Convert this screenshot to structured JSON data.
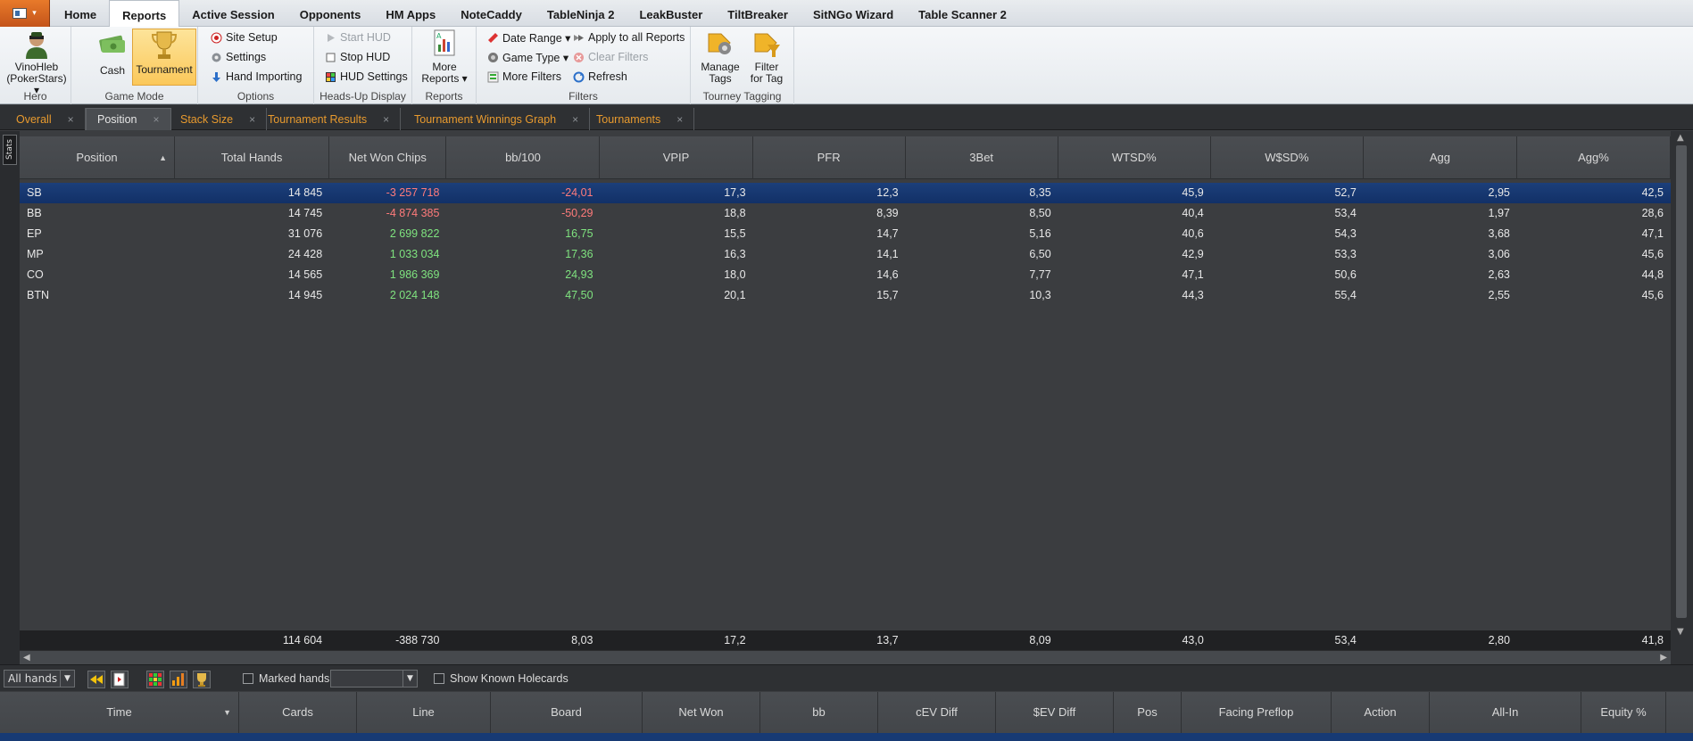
{
  "menu": {
    "items": [
      "Home",
      "Reports",
      "Active Session",
      "Opponents",
      "HM Apps",
      "NoteCaddy",
      "TableNinja 2",
      "LeakBuster",
      "TiltBreaker",
      "SitNGo Wizard",
      "Table Scanner 2"
    ],
    "active": "Reports"
  },
  "ribbon": {
    "hero": {
      "name": "VinoHleb",
      "site": "(PokerStars) ▾",
      "group_label": "Hero"
    },
    "game_mode": {
      "cash": "Cash",
      "tournament": "Tournament",
      "group_label": "Game Mode"
    },
    "options": {
      "site_setup": "Site Setup",
      "settings": "Settings",
      "hand_importing": "Hand Importing",
      "group_label": "Options"
    },
    "hud": {
      "start": "Start HUD",
      "stop": "Stop HUD",
      "settings": "HUD Settings",
      "group_label": "Heads-Up Display"
    },
    "reports": {
      "more_line1": "More",
      "more_line2": "Reports ▾",
      "group_label": "Reports"
    },
    "filters": {
      "date_range": "Date Range ▾",
      "game_type": "Game Type ▾",
      "more_filters": "More Filters",
      "apply_all": "Apply to all Reports",
      "clear": "Clear Filters",
      "refresh": "Refresh",
      "group_label": "Filters"
    },
    "tagging": {
      "manage_line1": "Manage",
      "manage_line2": "Tags",
      "filter_line1": "Filter",
      "filter_line2": "for Tag",
      "group_label": "Tourney Tagging"
    }
  },
  "tabs": [
    {
      "label": "Overall",
      "active": false
    },
    {
      "label": "Position",
      "active": true
    },
    {
      "label": "Stack Size",
      "active": false
    },
    {
      "label": "Tournament Results",
      "active": false
    },
    {
      "label": "Tournament Winnings Graph",
      "active": false
    },
    {
      "label": "Tournaments",
      "active": false
    }
  ],
  "sidebar": {
    "stats_label": "Stats"
  },
  "grid": {
    "columns": [
      "Position",
      "Total Hands",
      "Net Won Chips",
      "bb/100",
      "VPIP",
      "PFR",
      "3Bet",
      "WTSD%",
      "W$SD%",
      "Agg",
      "Agg%"
    ],
    "rows": [
      [
        "SB",
        "14 845",
        "-3 257 718",
        "-24,01",
        "17,3",
        "12,3",
        "8,35",
        "45,9",
        "52,7",
        "2,95",
        "42,5"
      ],
      [
        "BB",
        "14 745",
        "-4 874 385",
        "-50,29",
        "18,8",
        "8,39",
        "8,50",
        "40,4",
        "53,4",
        "1,97",
        "28,6"
      ],
      [
        "EP",
        "31 076",
        "2 699 822",
        "16,75",
        "15,5",
        "14,7",
        "5,16",
        "40,6",
        "54,3",
        "3,68",
        "47,1"
      ],
      [
        "MP",
        "24 428",
        "1 033 034",
        "17,36",
        "16,3",
        "14,1",
        "6,50",
        "42,9",
        "53,3",
        "3,06",
        "45,6"
      ],
      [
        "CO",
        "14 565",
        "1 986 369",
        "24,93",
        "18,0",
        "14,6",
        "7,77",
        "47,1",
        "50,6",
        "2,63",
        "44,8"
      ],
      [
        "BTN",
        "14 945",
        "2 024 148",
        "47,50",
        "20,1",
        "15,7",
        "10,3",
        "44,3",
        "55,4",
        "2,55",
        "45,6"
      ]
    ],
    "selected_row": 0,
    "totals": [
      "",
      "114 604",
      "-388 730",
      "8,03",
      "17,2",
      "13,7",
      "8,09",
      "43,0",
      "53,4",
      "2,80",
      "41,8"
    ]
  },
  "hands_toolbar": {
    "filter_value": "All hands",
    "marked_hands": "Marked hands",
    "show_holecards": "Show Known Holecards"
  },
  "hands_grid": {
    "columns": [
      "Time",
      "Cards",
      "Line",
      "Board",
      "Net Won",
      "bb",
      "cEV Diff",
      "$EV Diff",
      "Pos",
      "Facing Preflop",
      "Action",
      "All-In",
      "Equity %"
    ]
  },
  "colors": {
    "negative": "#ff7b7b",
    "positive": "#7fe37f",
    "tab_text": "#e89a2e",
    "selected_row": "#1c3f7a"
  }
}
